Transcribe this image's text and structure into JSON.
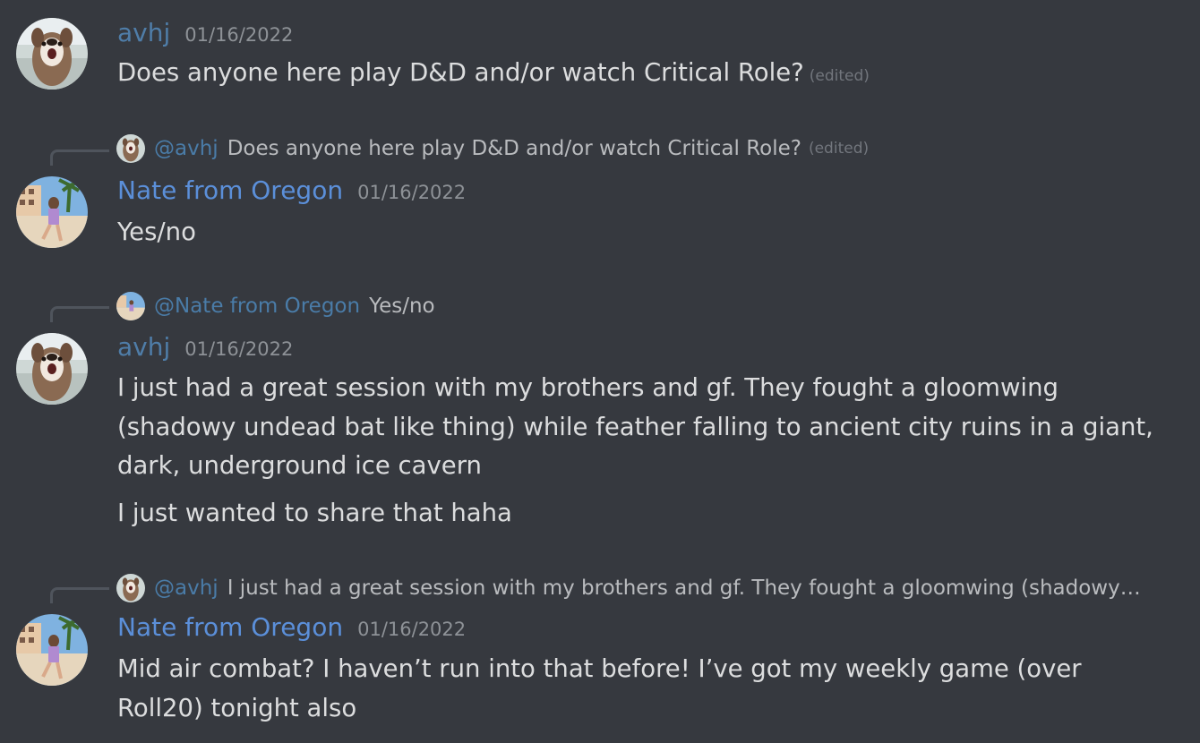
{
  "messages": [
    {
      "author": "avhj",
      "timestamp": "01/16/2022",
      "avatar_icon": "dog-avatar-icon",
      "lines": [
        "Does anyone here play D&D and/or watch Critical Role?"
      ],
      "edited_label": "(edited)"
    },
    {
      "reply": {
        "mention": "@avhj",
        "text": "Does anyone here play D&D and/or watch Critical Role?",
        "edited_label": "(edited)",
        "avatar_icon": "dog-avatar-icon"
      },
      "author": "Nate from Oregon",
      "timestamp": "01/16/2022",
      "avatar_icon": "beach-person-avatar-icon",
      "lines": [
        "Yes/no"
      ]
    },
    {
      "reply": {
        "mention": "@Nate from Oregon",
        "text": "Yes/no",
        "avatar_icon": "beach-person-avatar-icon"
      },
      "author": "avhj",
      "timestamp": "01/16/2022",
      "avatar_icon": "dog-avatar-icon",
      "lines": [
        "I just had a great session with my brothers and gf. They fought a gloomwing (shadowy undead bat like thing) while feather falling to ancient city ruins in a giant, dark, underground ice cavern",
        "I just wanted to share that haha"
      ]
    },
    {
      "reply": {
        "mention": "@avhj",
        "text": "I just had a great session with my brothers and gf. They fought a gloomwing (shadowy …",
        "avatar_icon": "dog-avatar-icon"
      },
      "author": "Nate from Oregon",
      "timestamp": "01/16/2022",
      "avatar_icon": "beach-person-avatar-icon",
      "lines": [
        "Mid air combat? I haven’t run into that before! I’ve got my weekly game (over Roll20) tonight also"
      ]
    }
  ],
  "colors": {
    "background": "#36393f",
    "username_nate": "#5b8fd9",
    "username_avhj": "#4f7da8",
    "timestamp": "#8e9297",
    "message_text": "#dcddde",
    "mention": "#4a7ca8",
    "edited": "#72767d"
  }
}
